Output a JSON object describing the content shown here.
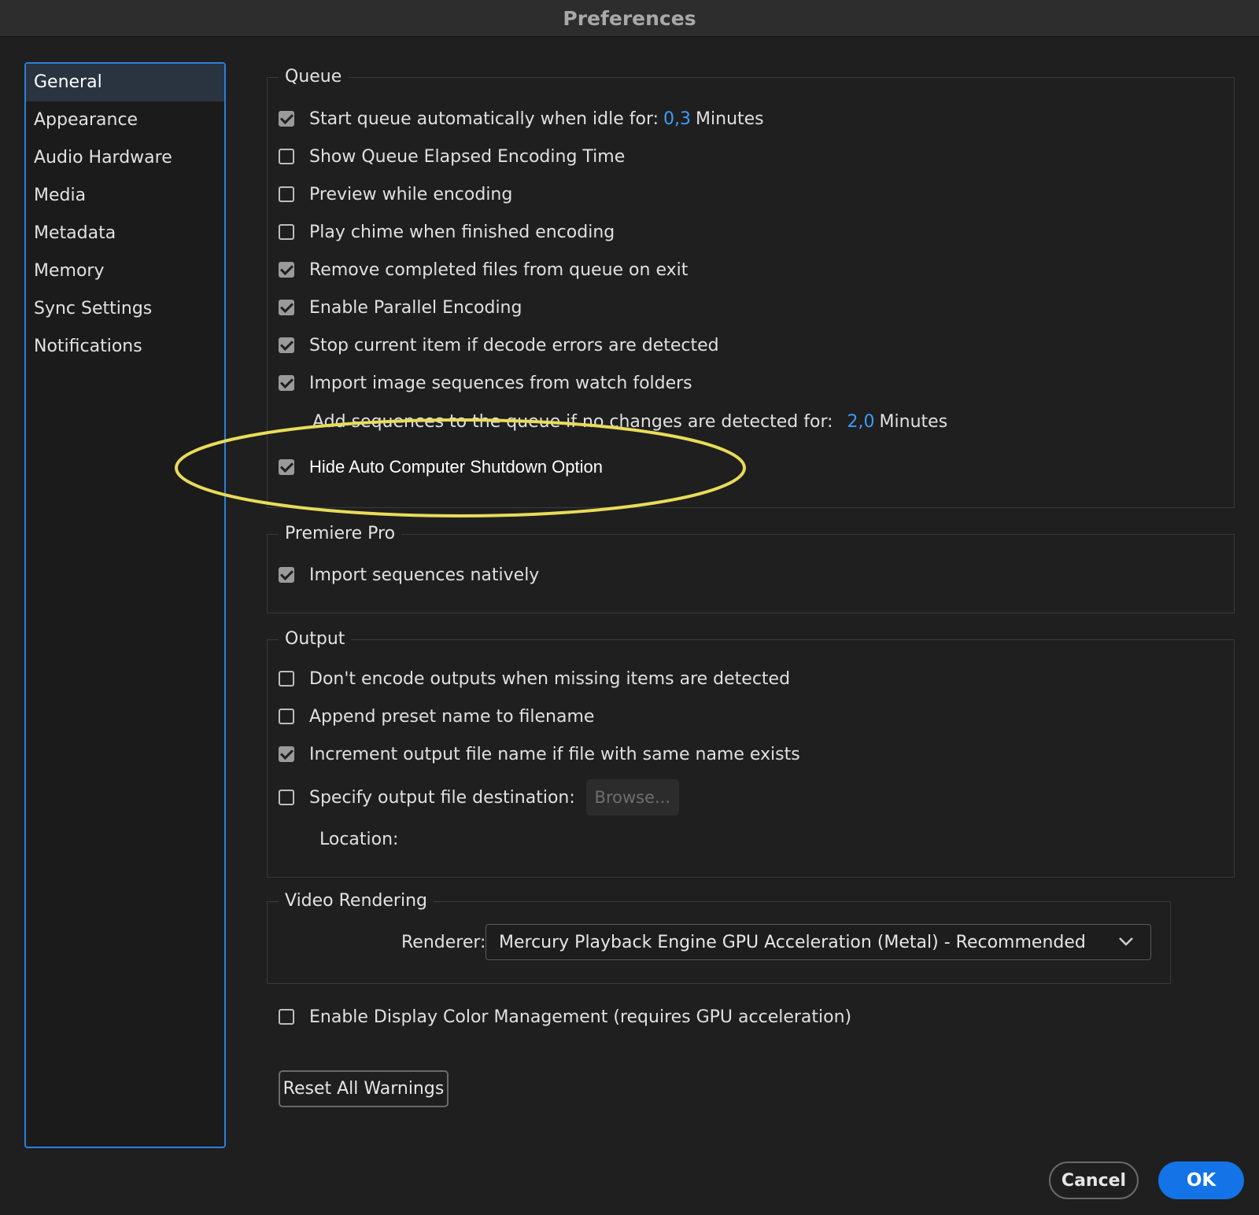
{
  "window": {
    "title": "Preferences"
  },
  "sidebar": {
    "items": [
      {
        "label": "General",
        "active": true
      },
      {
        "label": "Appearance"
      },
      {
        "label": "Audio Hardware"
      },
      {
        "label": "Media"
      },
      {
        "label": "Metadata"
      },
      {
        "label": "Memory"
      },
      {
        "label": "Sync Settings"
      },
      {
        "label": "Notifications"
      }
    ]
  },
  "queue": {
    "legend": "Queue",
    "start_auto": {
      "label": "Start queue automatically when idle for:",
      "value": "0,3",
      "unit": "Minutes",
      "checked": true
    },
    "show_elapsed": {
      "label": "Show Queue Elapsed Encoding Time",
      "checked": false
    },
    "preview": {
      "label": "Preview while encoding",
      "checked": false
    },
    "chime": {
      "label": "Play chime when finished encoding",
      "checked": false
    },
    "remove_completed": {
      "label": "Remove completed files from queue on exit",
      "checked": true
    },
    "parallel": {
      "label": "Enable Parallel Encoding",
      "checked": true
    },
    "stop_current": {
      "label": "Stop current item if decode errors are detected",
      "checked": true
    },
    "import_image_seq": {
      "label": "Import image sequences from watch folders",
      "checked": true
    },
    "add_sequences": {
      "label": "Add sequences to the queue if no changes are detected for:",
      "value": "2,0",
      "unit": "Minutes"
    },
    "hide_shutdown": {
      "label": "Hide Auto Computer Shutdown Option",
      "checked": true
    }
  },
  "premiere": {
    "legend": "Premiere Pro",
    "import_native": {
      "label": "Import sequences natively",
      "checked": true
    }
  },
  "output": {
    "legend": "Output",
    "dont_encode": {
      "label": "Don't encode outputs when missing items are detected",
      "checked": false
    },
    "append_preset": {
      "label": "Append preset name to filename",
      "checked": false
    },
    "increment": {
      "label": "Increment output file name if file with same name exists",
      "checked": true
    },
    "specify_dest": {
      "label": "Specify output file destination:",
      "checked": false
    },
    "browse_label": "Browse...",
    "location_label": "Location:"
  },
  "video_rendering": {
    "legend": "Video Rendering",
    "renderer_label": "Renderer:",
    "renderer_value": "Mercury Playback Engine GPU Acceleration (Metal) - Recommended"
  },
  "display_color": {
    "label": "Enable Display Color Management (requires GPU acceleration)",
    "checked": false
  },
  "reset_warnings": "Reset All Warnings",
  "footer": {
    "cancel": "Cancel",
    "ok": "OK"
  },
  "colors": {
    "accent": "#1473e6",
    "highlight_ring": "#e8dc5a",
    "value_blue": "#3d9bff"
  }
}
